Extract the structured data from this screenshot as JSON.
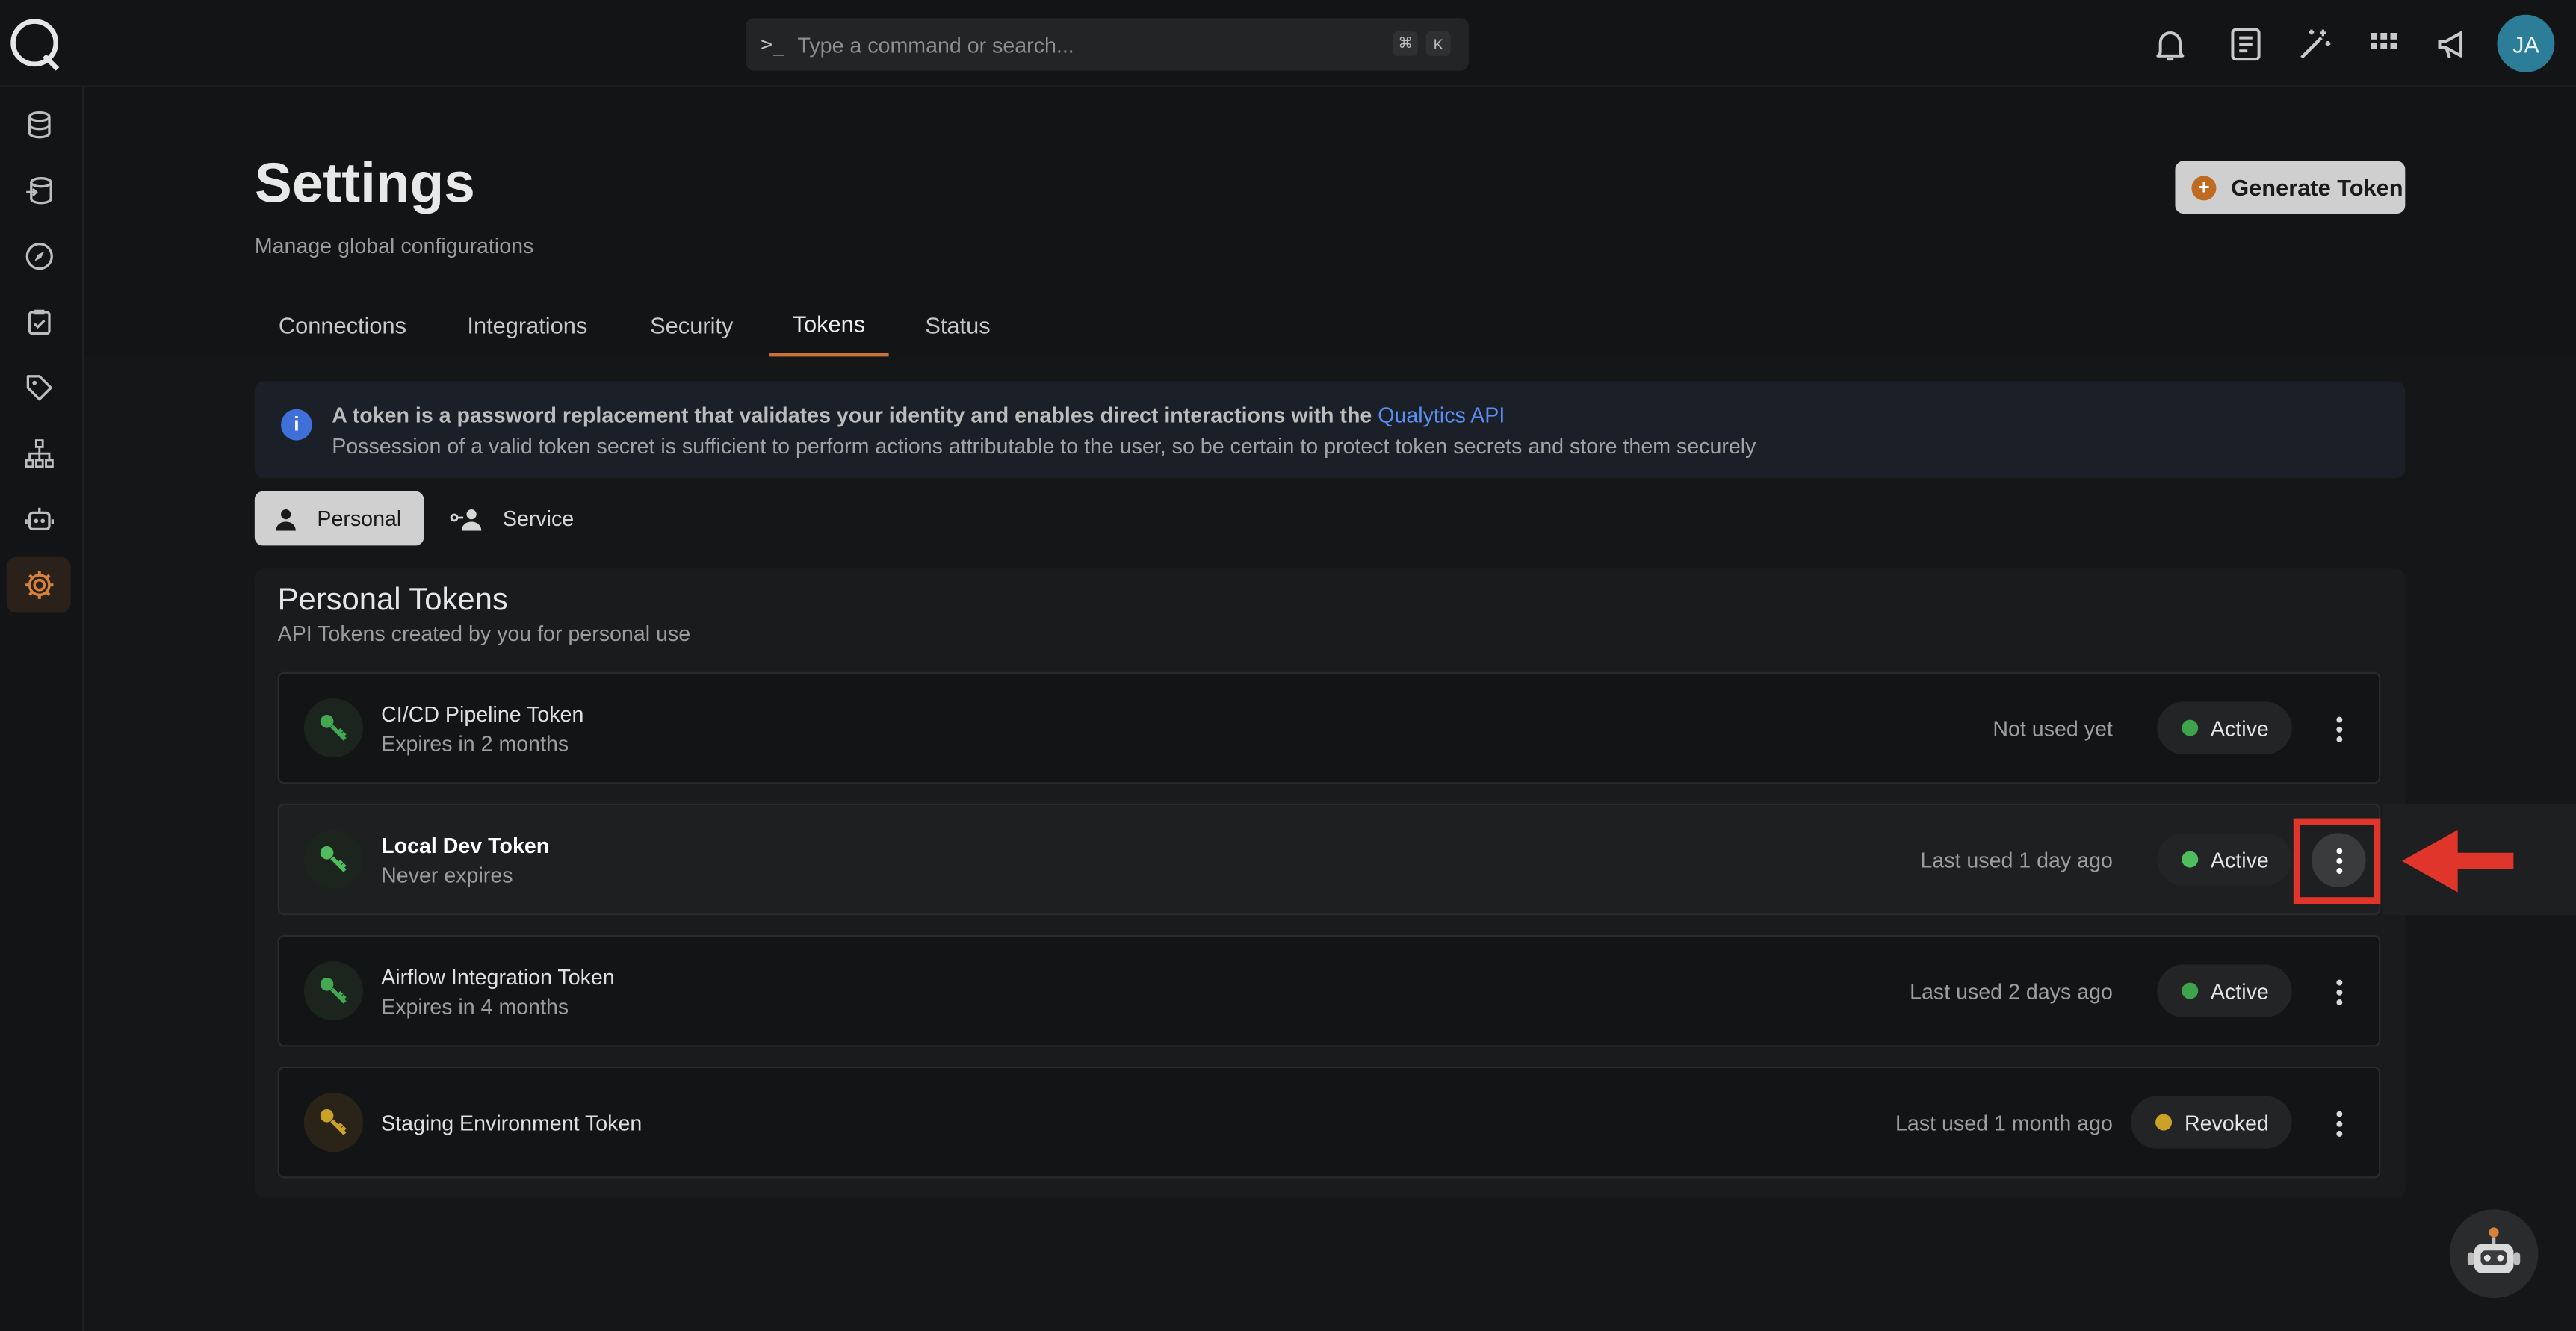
{
  "search": {
    "placeholder": "Type a command or search...",
    "kbd": [
      "⌘",
      "K"
    ]
  },
  "user": {
    "initials": "JA"
  },
  "page": {
    "title": "Settings",
    "subtitle": "Manage global configurations",
    "generate_label": "Generate Token"
  },
  "tabs": [
    {
      "label": "Connections"
    },
    {
      "label": "Integrations"
    },
    {
      "label": "Security"
    },
    {
      "label": "Tokens",
      "active": true
    },
    {
      "label": "Status"
    }
  ],
  "info": {
    "line1": "A token is a password replacement that validates your identity and enables direct interactions with the ",
    "link": "Qualytics API",
    "line2": "Possession of a valid token secret is sufficient to perform actions attributable to the user, so be certain to protect token secrets and store them securely"
  },
  "segments": {
    "personal": "Personal",
    "service": "Service"
  },
  "panel": {
    "title": "Personal Tokens",
    "subtitle": "API Tokens created by you for personal use"
  },
  "tokens": [
    {
      "name": "CI/CD Pipeline Token",
      "expires": "Expires in 2 months",
      "used": "Not used yet",
      "status": "Active",
      "status_color": "#3fa34d"
    },
    {
      "name": "Local Dev Token",
      "expires": "Never expires",
      "used": "Last used 1 day ago",
      "status": "Active",
      "status_color": "#3fa34d"
    },
    {
      "name": "Airflow Integration Token",
      "expires": "Expires in 4 months",
      "used": "Last used 2 days ago",
      "status": "Active",
      "status_color": "#3fa34d"
    },
    {
      "name": "Staging Environment Token",
      "expires": "",
      "used": "Last used 1 month ago",
      "status": "Revoked",
      "status_color": "#c9a227"
    }
  ],
  "colors": {
    "accent": "#c9733a",
    "active_dot": "#3fa34d",
    "revoked_dot": "#c9a227",
    "annotation": "#e0352b"
  }
}
